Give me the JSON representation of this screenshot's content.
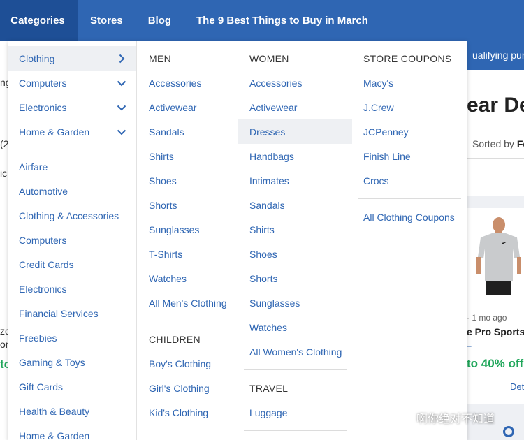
{
  "nav": {
    "items": [
      {
        "label": "Categories"
      },
      {
        "label": "Stores"
      },
      {
        "label": "Blog"
      },
      {
        "label": "The 9 Best Things to Buy in March"
      }
    ]
  },
  "background": {
    "banner_text": "ualifying purc",
    "title_text": "ear De",
    "sort_prefix": "Sorted by ",
    "sort_value": "Fe",
    "meta_text": "· 1 mo ago",
    "product_name": "e Pro Sportsw",
    "dash_text": "–",
    "discount_text": "to 40% off",
    "details_text": "Det",
    "left_fragments": [
      "ng",
      "(2",
      "ic",
      "zo",
      "om",
      "to"
    ]
  },
  "menu": {
    "left": {
      "expandable": [
        {
          "label": "Clothing",
          "chevron": "chevron-right"
        },
        {
          "label": "Computers",
          "chevron": "chevron-down"
        },
        {
          "label": "Electronics",
          "chevron": "chevron-down"
        },
        {
          "label": "Home & Garden",
          "chevron": "chevron-down"
        }
      ],
      "categories": [
        {
          "label": "Airfare"
        },
        {
          "label": "Automotive"
        },
        {
          "label": "Clothing & Accessories"
        },
        {
          "label": "Computers"
        },
        {
          "label": "Credit Cards"
        },
        {
          "label": "Electronics"
        },
        {
          "label": "Financial Services"
        },
        {
          "label": "Freebies"
        },
        {
          "label": "Gaming & Toys"
        },
        {
          "label": "Gift Cards"
        },
        {
          "label": "Health & Beauty"
        },
        {
          "label": "Home & Garden"
        }
      ]
    },
    "men": {
      "heading": "MEN",
      "links": [
        {
          "label": "Accessories"
        },
        {
          "label": "Activewear"
        },
        {
          "label": "Sandals"
        },
        {
          "label": "Shirts"
        },
        {
          "label": "Shoes"
        },
        {
          "label": "Shorts"
        },
        {
          "label": "Sunglasses"
        },
        {
          "label": "T-Shirts"
        },
        {
          "label": "Watches"
        },
        {
          "label": "All Men's Clothing"
        }
      ]
    },
    "children": {
      "heading": "CHILDREN",
      "links": [
        {
          "label": "Boy's Clothing"
        },
        {
          "label": "Girl's Clothing"
        },
        {
          "label": "Kid's Clothing"
        }
      ]
    },
    "women": {
      "heading": "WOMEN",
      "links": [
        {
          "label": "Accessories"
        },
        {
          "label": "Activewear"
        },
        {
          "label": "Dresses"
        },
        {
          "label": "Handbags"
        },
        {
          "label": "Intimates"
        },
        {
          "label": "Sandals"
        },
        {
          "label": "Shirts"
        },
        {
          "label": "Shoes"
        },
        {
          "label": "Shorts"
        },
        {
          "label": "Sunglasses"
        },
        {
          "label": "Watches"
        },
        {
          "label": "All Women's Clothing"
        }
      ]
    },
    "travel": {
      "heading": "TRAVEL",
      "links": [
        {
          "label": "Luggage"
        }
      ]
    },
    "store_coupons": {
      "heading": "STORE COUPONS",
      "links": [
        {
          "label": "Macy's"
        },
        {
          "label": "J.Crew"
        },
        {
          "label": "JCPenney"
        },
        {
          "label": "Finish Line"
        },
        {
          "label": "Crocs"
        }
      ],
      "all_link": "All Clothing Coupons"
    }
  },
  "watermark": {
    "text": "啊你绝对不知道",
    "icon": "wechat-icon"
  },
  "colors": {
    "nav_bg": "#2f66b3",
    "nav_active": "#1e4f96",
    "link": "#2f66b3",
    "hover_bg": "#eef0f3",
    "discount": "#1fa65a"
  }
}
